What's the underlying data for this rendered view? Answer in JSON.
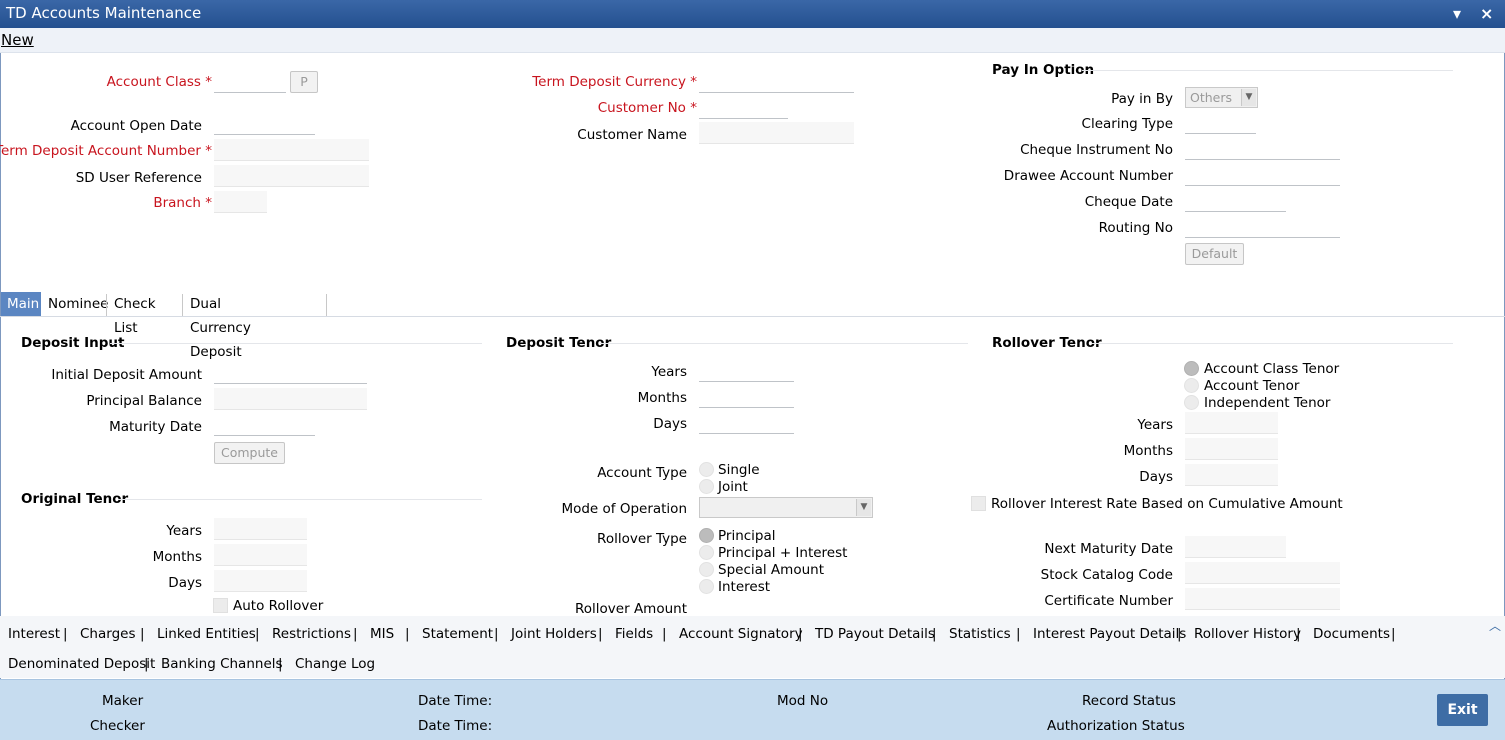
{
  "window": {
    "title": "TD Accounts Maintenance",
    "minimize_glyph": "▾",
    "close_glyph": "×"
  },
  "menu": {
    "new_label": "New"
  },
  "header": {
    "account_class": "Account Class",
    "p_button": "P",
    "account_open_date": "Account Open Date",
    "td_account_number": "Term Deposit Account Number",
    "sd_user_reference": "SD User Reference",
    "branch": "Branch",
    "td_currency": "Term Deposit Currency",
    "customer_no": "Customer No",
    "customer_name": "Customer Name",
    "required_mark": "*"
  },
  "pay_in": {
    "title": "Pay In Option",
    "pay_in_by": "Pay in By",
    "pay_in_by_value": "Others",
    "clearing_type": "Clearing Type",
    "cheque_instrument_no": "Cheque Instrument No",
    "drawee_account_number": "Drawee Account Number",
    "cheque_date": "Cheque Date",
    "routing_no": "Routing No",
    "default_button": "Default"
  },
  "tabs": [
    "Main",
    "Nominee",
    "Check List",
    "Dual Currency Deposit"
  ],
  "deposit_input": {
    "title": "Deposit Input",
    "initial_deposit_amount": "Initial Deposit Amount",
    "principal_balance": "Principal Balance",
    "maturity_date": "Maturity Date",
    "compute_button": "Compute"
  },
  "original_tenor": {
    "title": "Original Tenor",
    "years": "Years",
    "months": "Months",
    "days": "Days",
    "auto_rollover": "Auto Rollover"
  },
  "deposit_tenor": {
    "title": "Deposit Tenor",
    "years": "Years",
    "months": "Months",
    "days": "Days",
    "account_type": "Account Type",
    "single": "Single",
    "joint": "Joint",
    "mode_of_operation": "Mode of Operation",
    "rollover_type": "Rollover Type",
    "principal": "Principal",
    "principal_interest": "Principal + Interest",
    "special_amount": "Special Amount",
    "interest": "Interest",
    "rollover_amount": "Rollover Amount"
  },
  "rollover_tenor": {
    "title": "Rollover Tenor",
    "account_class_tenor": "Account Class Tenor",
    "account_tenor": "Account Tenor",
    "independent_tenor": "Independent Tenor",
    "years": "Years",
    "months": "Months",
    "days": "Days",
    "rollover_interest_rate": "Rollover Interest Rate Based on Cumulative Amount",
    "next_maturity_date": "Next Maturity Date",
    "stock_catalog_code": "Stock Catalog Code",
    "certificate_number": "Certificate Number"
  },
  "bottom_links_row1": [
    "Interest",
    "Charges",
    "Linked Entities",
    "Restrictions",
    "MIS",
    "Statement",
    "Joint Holders",
    "Fields",
    "Account Signatory",
    "TD Payout Details",
    "Statistics",
    "Interest Payout Details",
    "Rollover History",
    "Documents"
  ],
  "bottom_links_row2": [
    "Denominated Deposit",
    "Banking Channels",
    "Change Log"
  ],
  "link_separator": "|",
  "scroll_up_glyph": "︿",
  "footer": {
    "maker": "Maker",
    "checker": "Checker",
    "date_time_1": "Date Time:",
    "date_time_2": "Date Time:",
    "mod_no": "Mod No",
    "record_status": "Record Status",
    "authorization_status": "Authorization Status",
    "exit_button": "Exit"
  },
  "colors": {
    "title_bar": "#2f5d9c",
    "required": "#c8141e",
    "active_tab": "#5b86c2",
    "footer_bg": "#c6dcef",
    "exit_button": "#3e6da5"
  }
}
